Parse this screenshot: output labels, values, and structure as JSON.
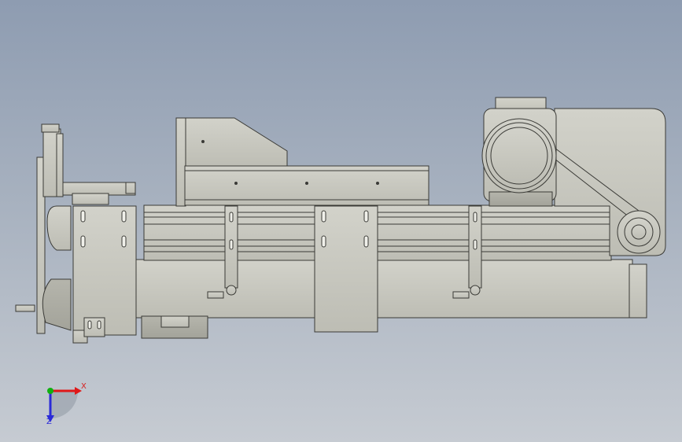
{
  "viewport": {
    "background_top": "#8e9cb1",
    "background_bottom": "#c6cbd2",
    "model_fill": "#c9c9c0",
    "model_stroke": "#3a3a36"
  },
  "triad": {
    "x_label": "X",
    "z_label": "Z",
    "x_color": "#e01818",
    "z_color": "#2a2ad8",
    "y_color": "#10b010"
  }
}
